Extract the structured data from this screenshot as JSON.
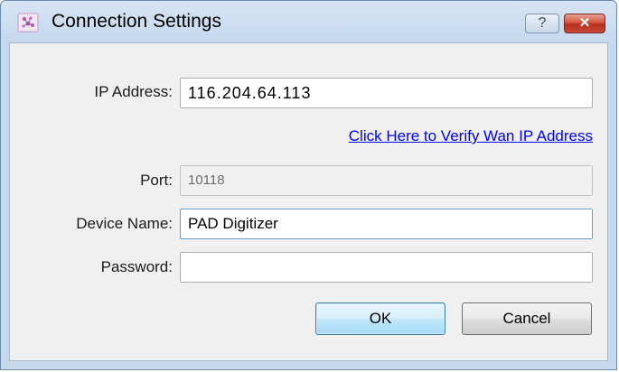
{
  "window": {
    "title": "Connection Settings",
    "help_label": "?",
    "close_label": "✕",
    "icon": "app-icon"
  },
  "form": {
    "ip_label": "IP Address:",
    "ip_value": "116.204.64.113",
    "verify_link": "Click Here to Verify Wan IP Address",
    "port_label": "Port:",
    "port_value": "10118",
    "device_label": "Device Name:",
    "device_value": "PAD Digitizer",
    "password_label": "Password:",
    "password_value": ""
  },
  "buttons": {
    "ok_label": "OK",
    "cancel_label": "Cancel"
  },
  "colors": {
    "title_bar": "#c5d8ee",
    "close_button": "#c9493a",
    "link": "#0000ff",
    "ok_button_border": "#3c7fb1"
  }
}
